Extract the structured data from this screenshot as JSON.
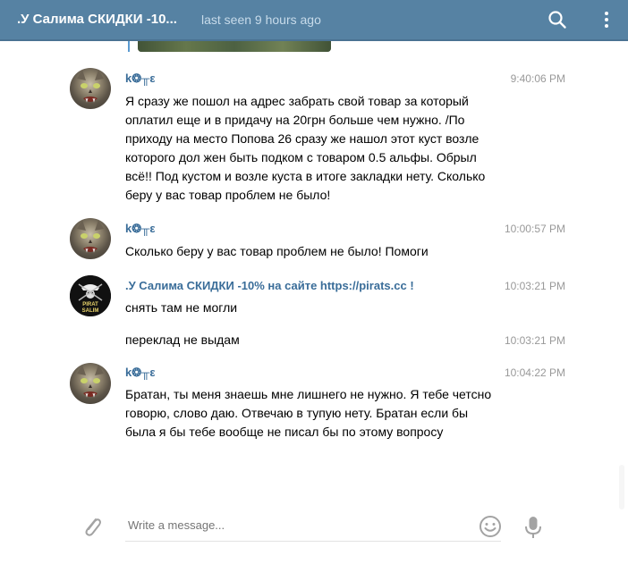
{
  "header": {
    "title": ".У Салима СКИДКИ -10...",
    "status": "last seen 9 hours ago"
  },
  "messages": [
    {
      "sender": "k❂╥ε",
      "time": "9:40:06 PM",
      "text": "Я сразу же пошол на адрес забрать свой товар за который оплатил еще и в придачу на 20грн больше чем нужно. /По приходу на место Попова 26 сразу же нашол этот куст возле которого дол жен быть подком с товаром 0.5 альфы. Обрыл всё!! Под кустом и возле куста в итоге закладки нету. Сколько беру у вас товар проблем не было!"
    },
    {
      "sender": "k❂╥ε",
      "time": "10:00:57 PM",
      "text": "Сколько беру у вас товар проблем не было! Помоги"
    },
    {
      "sender": ".У Салима СКИДКИ -10% на сайте https://pirats.cc !",
      "time": "10:03:21 PM",
      "text": "снять там не могли"
    },
    {
      "sender": "",
      "time": "10:03:21 PM",
      "text": "переклад не выдам"
    },
    {
      "sender": "k❂╥ε",
      "time": "10:04:22 PM",
      "text": "Братан, ты меня знаешь мне лишнего не нужно. Я тебе четсно говорю, слово даю. Отвечаю в тупую нету. Братан если бы была я бы тебе вообще не писал бы по этому вопросу"
    }
  ],
  "avatar_badge": {
    "line1": "PIRAT",
    "line2": "SALIM"
  },
  "composer": {
    "placeholder": "Write a message..."
  },
  "colors": {
    "header_bg": "#5682a3",
    "sender_name": "#3a6d99",
    "time": "#999999"
  }
}
